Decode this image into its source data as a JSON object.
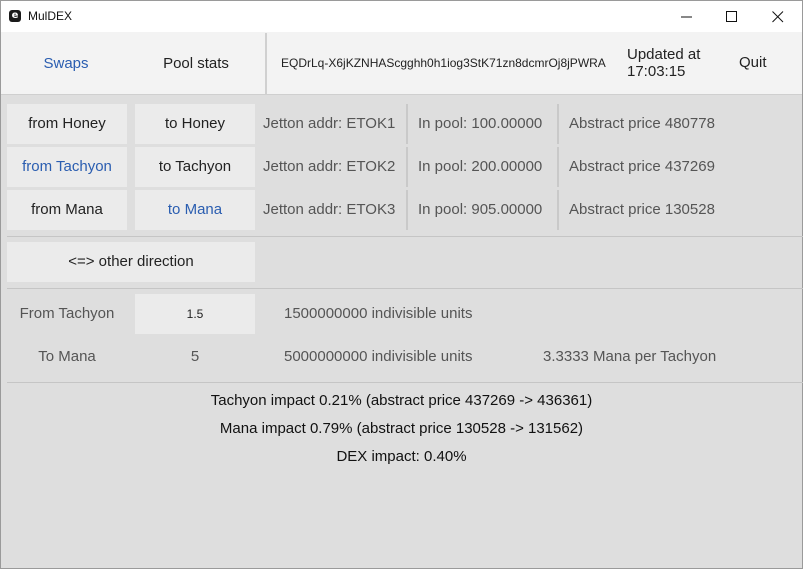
{
  "window": {
    "title": "MulDEX",
    "app_icon_letter": "e",
    "controls": [
      "minimize-icon",
      "maximize-icon",
      "close-icon"
    ]
  },
  "header": {
    "tab_swaps": "Swaps",
    "tab_pool_stats": "Pool stats",
    "pool_address": "EQDrLq-X6jKZNHAScgghh0h1iog3StK71zn8dcmrOj8jPWRA",
    "updated_label": "Updated at",
    "updated_time": "17:03:15",
    "quit": "Quit"
  },
  "tokens": [
    {
      "from_label": "from Honey",
      "to_label": "to Honey",
      "jetton": "Jetton addr: ETOK1",
      "pool": "In pool: 100.00000",
      "price": "Abstract price 480778",
      "from_selected": false,
      "to_selected": false
    },
    {
      "from_label": "from Tachyon",
      "to_label": "to Tachyon",
      "jetton": "Jetton addr: ETOK2",
      "pool": "In pool: 200.00000",
      "price": "Abstract price 437269",
      "from_selected": true,
      "to_selected": false
    },
    {
      "from_label": "from Mana",
      "to_label": "to Mana",
      "jetton": "Jetton addr: ETOK3",
      "pool": "In pool: 905.00000",
      "price": "Abstract price 130528",
      "from_selected": false,
      "to_selected": true
    }
  ],
  "direction_button": "<=> other direction",
  "swap": {
    "from_label": "From Tachyon",
    "from_amount": "1.5",
    "from_units": "1500000000 indivisible units",
    "to_label": "To Mana",
    "to_amount": "5",
    "to_units": "5000000000 indivisible units",
    "rate": "3.3333 Mana per Tachyon"
  },
  "impacts": {
    "tachyon": "Tachyon impact 0.21% (abstract price 437269 -> 436361)",
    "mana": "Mana impact 0.79% (abstract price 130528 -> 131562)",
    "dex": "DEX impact: 0.40%"
  },
  "colors": {
    "accent": "#2a5db0",
    "background": "#dedede",
    "button": "#ebebeb",
    "topbar": "#f3f3f3"
  }
}
